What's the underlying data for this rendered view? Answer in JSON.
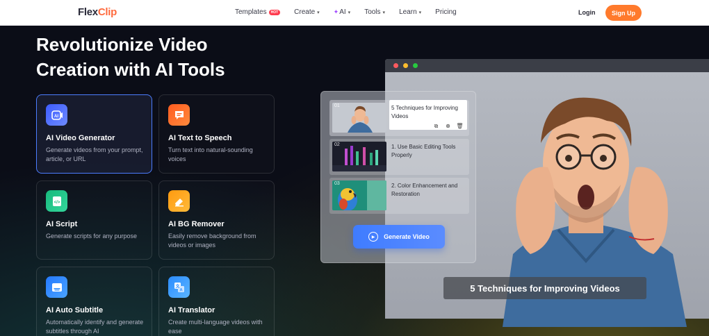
{
  "nav": {
    "logo_main": "Flex",
    "logo_accent": "Clip",
    "links": [
      {
        "label": "Templates",
        "badge": "HOT"
      },
      {
        "label": "Create",
        "chevron": "▾"
      },
      {
        "label": "AI",
        "icon": "sparkle-icon",
        "chevron": "▾"
      },
      {
        "label": "Tools",
        "chevron": "▾"
      },
      {
        "label": "Learn",
        "chevron": "▾"
      },
      {
        "label": "Pricing"
      }
    ],
    "login": "Login",
    "signup": "Sign Up"
  },
  "hero": {
    "title_line1": "Revolutionize Video",
    "title_line2": "Creation with AI Tools",
    "tools": [
      {
        "title": "AI Video Generator",
        "desc": "Generate videos from your prompt, article, or URL",
        "icon": "ai-video-icon",
        "color": "#4a6cff",
        "glyph": "AI"
      },
      {
        "title": "AI Text to Speech",
        "desc": "Turn text into natural-sounding voices",
        "icon": "speech-bubble-icon",
        "color": "#ff6b2c",
        "glyph": "☰"
      },
      {
        "title": "AI Script",
        "desc": "Generate scripts for any purpose",
        "icon": "script-icon",
        "color": "#1fc48a",
        "glyph": "</>"
      },
      {
        "title": "AI BG Remover",
        "desc": "Easily remove background from videos or images",
        "icon": "eraser-icon",
        "color": "#ffa21a",
        "glyph": "⌫"
      },
      {
        "title": "AI Auto Subtitle",
        "desc": "Automatically identify and generate subtitles through AI",
        "icon": "subtitle-icon",
        "color": "#2f8cff",
        "glyph": "▭"
      },
      {
        "title": "AI Translator",
        "desc": "Create multi-language videos with ease",
        "icon": "translate-icon",
        "color": "#3a9bff",
        "glyph": "文"
      }
    ]
  },
  "preview": {
    "scenes": [
      {
        "num": "01",
        "text": "5 Techniques for Improving Videos"
      },
      {
        "num": "02",
        "text": "1. Use Basic Editing Tools Properly"
      },
      {
        "num": "03",
        "text": "2. Color Enhancement and Restoration"
      }
    ],
    "generate_label": "Generate Video",
    "caption": "5 Techniques for Improving Videos"
  }
}
